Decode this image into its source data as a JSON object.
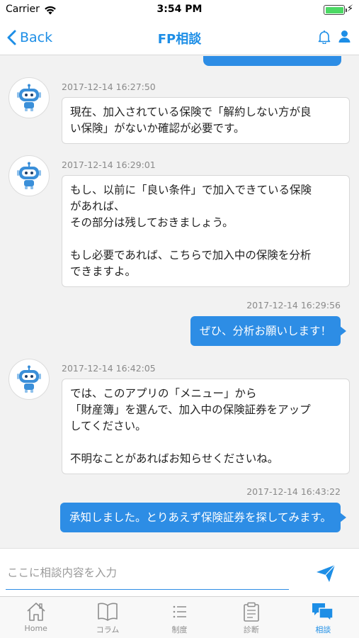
{
  "status_bar": {
    "carrier": "Carrier",
    "time": "3:54 PM",
    "battery_level": 1.0,
    "wifi_icon": "wifi-icon",
    "charging_icon": "bolt-icon"
  },
  "nav": {
    "back_label": "Back",
    "title": "FP相談",
    "icons": [
      "bell-icon",
      "user-icon"
    ],
    "accent_color": "#1d8ee6"
  },
  "messages": [
    {
      "sender": "bot",
      "timestamp": "2017-12-14 16:27:50",
      "text": "現在、加入されている保険で「解約しない方が良\nい保険」がないか確認が必要です。"
    },
    {
      "sender": "bot",
      "timestamp": "2017-12-14 16:29:01",
      "text": "もし、以前に「良い条件」で加入できている保険\nがあれば、\nその部分は残しておきましょう。\n\nもし必要であれば、こちらで加入中の保険を分析\nできますよ。"
    },
    {
      "sender": "user",
      "timestamp": "2017-12-14 16:29:56",
      "text": "ぜひ、分析お願いします！"
    },
    {
      "sender": "bot",
      "timestamp": "2017-12-14 16:42:05",
      "text": "では、このアプリの「メニュー」から\n「財産簿」を選んで、加入中の保険証券をアップ\nしてください。\n\n不明なことがあればお知らせくださいね。"
    },
    {
      "sender": "user",
      "timestamp": "2017-12-14 16:43:22",
      "text": "承知しました。とりあえず保険証券を探してみます。"
    }
  ],
  "input": {
    "placeholder": "ここに相談内容を入力",
    "value": "",
    "send_icon": "send-icon"
  },
  "tabs": [
    {
      "label": "Home",
      "icon": "home-icon",
      "active": false
    },
    {
      "label": "コラム",
      "icon": "book-icon",
      "active": false
    },
    {
      "label": "制度",
      "icon": "list-icon",
      "active": false
    },
    {
      "label": "診断",
      "icon": "clipboard-icon",
      "active": false
    },
    {
      "label": "相談",
      "icon": "chat-icon",
      "active": true
    }
  ],
  "colors": {
    "user_bubble": "#2d8de5",
    "bot_bubble": "#ffffff",
    "background": "#f2f2f2"
  }
}
